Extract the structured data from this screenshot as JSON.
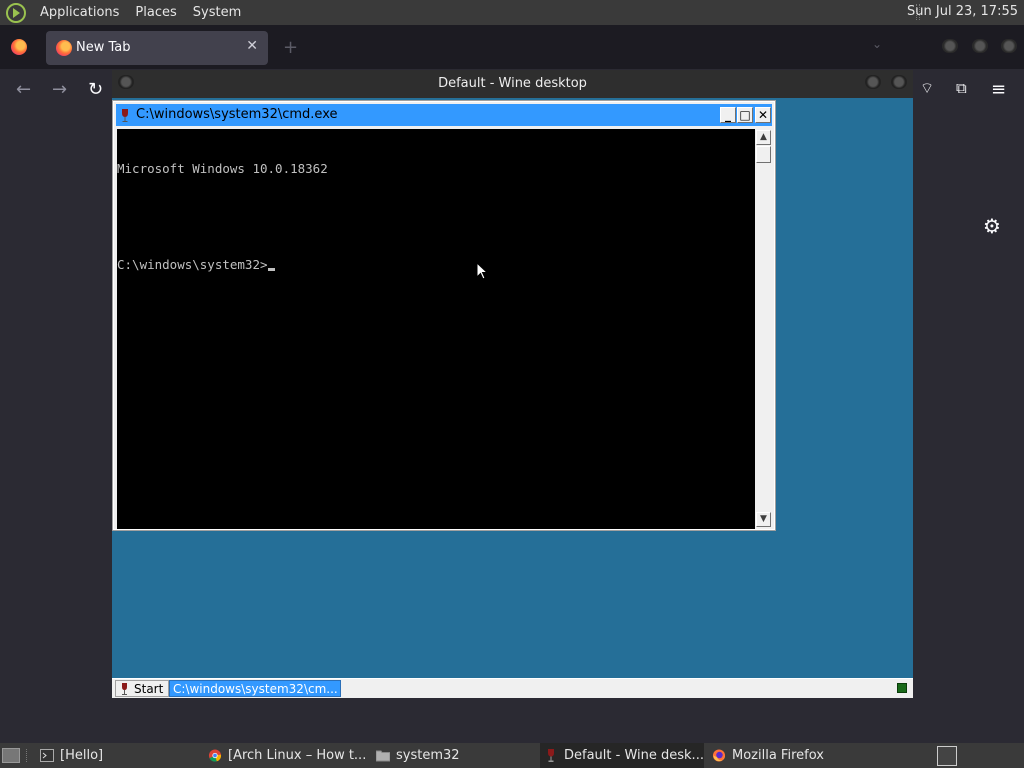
{
  "top_panel": {
    "menus": [
      "Applications",
      "Places",
      "System"
    ],
    "clock": "Sun Jul 23, 17:55"
  },
  "firefox": {
    "tab_title": "New Tab",
    "tab_close": "✕",
    "new_tab": "+",
    "list_all": "⌄",
    "nav": {
      "back": "←",
      "forward": "→",
      "reload": "↻",
      "pocket": "⌔",
      "extensions": "⧉",
      "menu": "≡"
    },
    "settings_icon": "⚙"
  },
  "wine_desktop": {
    "title": "Default - Wine desktop",
    "taskbar": {
      "start_label": "Start",
      "task_label": "C:\\windows\\system32\\cm..."
    }
  },
  "cmd": {
    "title": "C:\\windows\\system32\\cmd.exe",
    "buttons": {
      "minimize": "_",
      "maximize": "□",
      "close": "✕"
    },
    "lines": [
      "Microsoft Windows 10.0.18362",
      "",
      "C:\\windows\\system32>"
    ],
    "scroll_up": "▲",
    "scroll_down": "▼"
  },
  "bottom_panel": {
    "tasks": [
      {
        "label": "[Hello]",
        "icon": "terminal-icon"
      },
      {
        "label": "[Arch Linux – How t...",
        "icon": "chrome-icon"
      },
      {
        "label": "system32",
        "icon": "folder-icon"
      },
      {
        "label": "Default - Wine desk...",
        "icon": "wine-icon"
      },
      {
        "label": "Mozilla Firefox",
        "icon": "firefox-icon"
      }
    ]
  },
  "colors": {
    "wine_desktop_bg": "#256f98",
    "cmd_title_active": "#3399ff",
    "console_bg": "#000000",
    "console_fg": "#c0c0c0",
    "panel_bg": "#3a3a3a",
    "firefox_bg": "#2b2a33"
  }
}
